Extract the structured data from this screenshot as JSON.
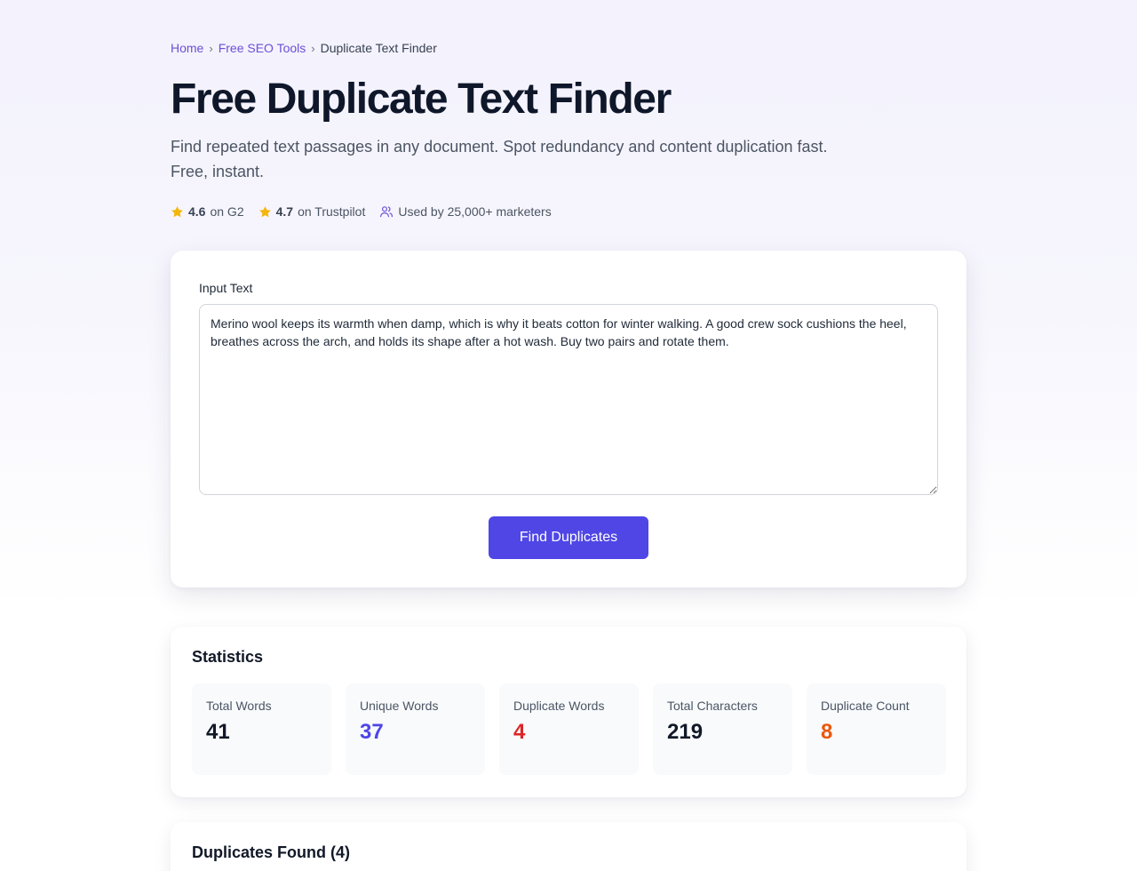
{
  "breadcrumb": {
    "home": "Home",
    "sep1": "›",
    "tools": "Free SEO Tools",
    "sep2": "›",
    "current": "Duplicate Text Finder"
  },
  "title": "Free Duplicate Text Finder",
  "subtitle": "Find repeated text passages in any document. Spot redundancy and content duplication fast. Free, instant.",
  "ratings": {
    "g2_score": "4.6",
    "g2_label": "on G2",
    "trustpilot_score": "4.7",
    "trustpilot_label": "on Trustpilot",
    "users_text": "Used by 25,000+ marketers",
    "star_color": "#f5b60b",
    "users_icon": "users-icon"
  },
  "input": {
    "label": "Input Text",
    "value": "Merino wool keeps its warmth when damp, which is why it beats cotton for winter walking. A good crew sock cushions the heel, breathes across the arch, and holds its shape after a hot wash. Buy two pairs and rotate them.",
    "button_label": "Find Duplicates"
  },
  "statistics": {
    "title": "Statistics",
    "items": [
      {
        "label": "Total Words",
        "value": "41",
        "color": "#111827"
      },
      {
        "label": "Unique Words",
        "value": "37",
        "color": "#4f46e5"
      },
      {
        "label": "Duplicate Words",
        "value": "4",
        "color": "#dc2626"
      },
      {
        "label": "Total Characters",
        "value": "219",
        "color": "#111827"
      },
      {
        "label": "Duplicate Count",
        "value": "8",
        "color": "#ea580c"
      }
    ]
  },
  "duplicates": {
    "title": "Duplicates Found (4)"
  },
  "colors": {
    "accent": "#4f46e5",
    "link": "#6d4fd6"
  }
}
